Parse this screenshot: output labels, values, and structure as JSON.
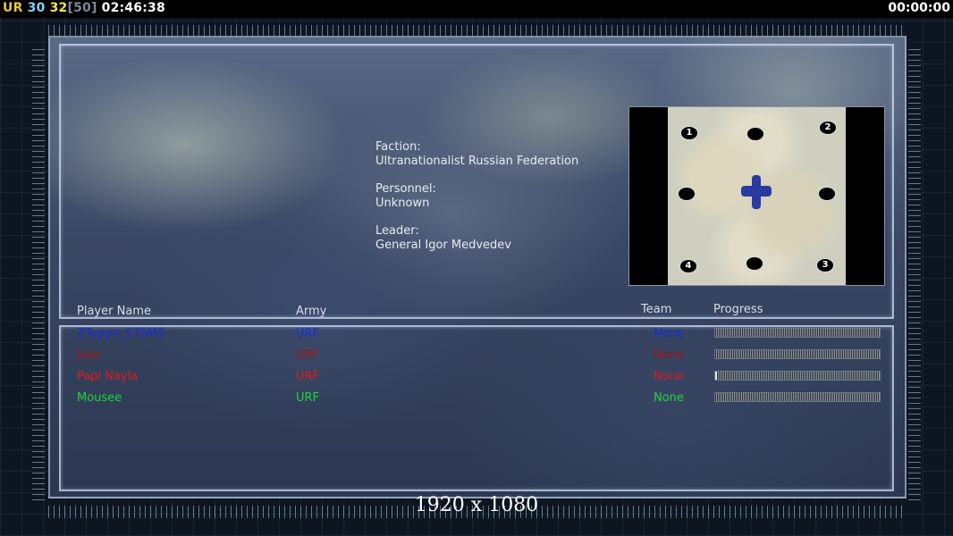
{
  "hud": {
    "left": {
      "faction": "UR",
      "value1": "30",
      "value2": "32",
      "bracket": "[50]",
      "clock": "02:46:38"
    },
    "right_clock": "00:00:00"
  },
  "faction_info": {
    "faction_label": "Faction:",
    "faction_value": "Ultranationalist Russian Federation",
    "personnel_label": "Personnel:",
    "personnel_value": "Unknown",
    "leader_label": "Leader:",
    "leader_value": "General Igor Medvedev"
  },
  "minimap": {
    "slots": [
      {
        "label": "1"
      },
      {
        "label": ""
      },
      {
        "label": "2"
      },
      {
        "label": ""
      },
      {
        "label": ""
      },
      {
        "label": "4"
      },
      {
        "label": ""
      },
      {
        "label": "3"
      }
    ]
  },
  "table": {
    "headers": {
      "player": "Player Name",
      "army": "Army",
      "team": "Team",
      "progress": "Progress"
    },
    "rows": [
      {
        "player": "ZTuppo_57SMS",
        "army": "URF",
        "team": "None",
        "progress": 0.0,
        "color": "#1a2ed8"
      },
      {
        "player": "Jose",
        "army": "URF",
        "team": "None",
        "progress": 0.0,
        "color": "#a01818"
      },
      {
        "player": "Papi Nayla",
        "army": "URF",
        "team": "None",
        "progress": 0.01,
        "color": "#e01b1b"
      },
      {
        "player": "Mousee",
        "army": "URF",
        "team": "None",
        "progress": 0.0,
        "color": "#22d23a"
      }
    ]
  },
  "resolution_label": "1920 x 1080"
}
